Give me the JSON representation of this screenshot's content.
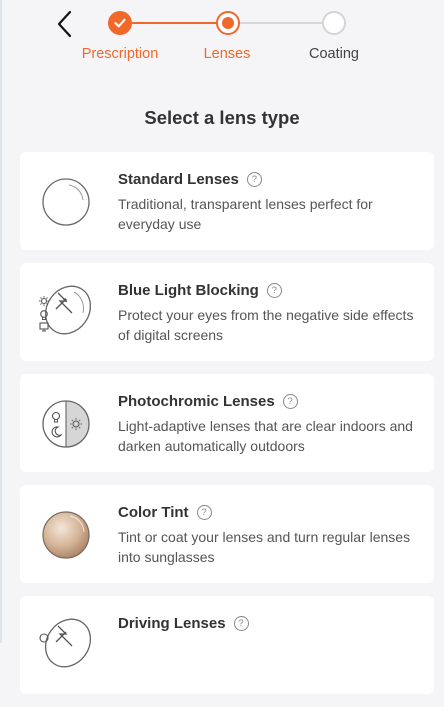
{
  "header": {
    "steps": [
      {
        "label": "Prescription",
        "state": "done"
      },
      {
        "label": "Lenses",
        "state": "active"
      },
      {
        "label": "Coating",
        "state": "todo"
      }
    ]
  },
  "page": {
    "title": "Select a lens type"
  },
  "lenses": [
    {
      "name": "Standard Lenses",
      "desc": "Traditional, transparent lenses perfect for everyday use",
      "icon": "clear-lens-icon"
    },
    {
      "name": "Blue Light Blocking",
      "desc": "Protect your eyes from the negative side effects of digital screens",
      "icon": "blue-light-lens-icon"
    },
    {
      "name": "Photochromic Lenses",
      "desc": "Light-adaptive lenses that are clear indoors and darken automatically outdoors",
      "icon": "photochromic-lens-icon"
    },
    {
      "name": "Color Tint",
      "desc": "Tint or coat your lenses and turn regular lenses into sunglasses",
      "icon": "tinted-lens-icon"
    },
    {
      "name": "Driving Lenses",
      "desc": "",
      "icon": "driving-lens-icon"
    }
  ],
  "help_glyph": "?",
  "colors": {
    "accent": "#f0682a",
    "inactive": "#d4d4d4",
    "tint": "#c9a384"
  }
}
